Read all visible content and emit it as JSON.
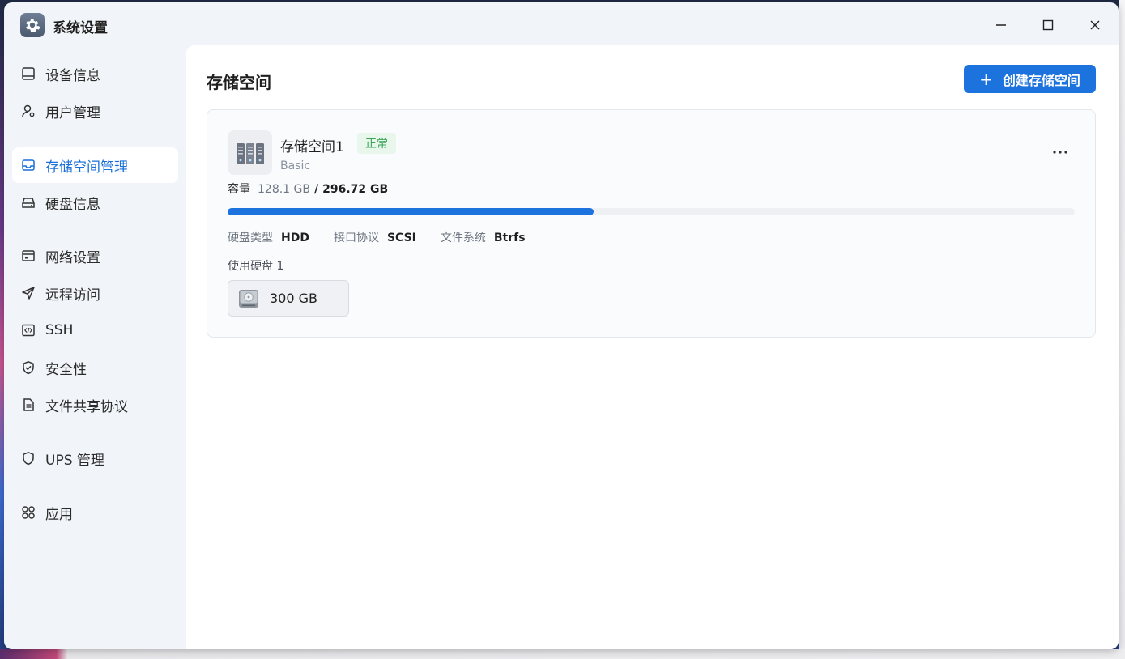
{
  "window": {
    "title": "系统设置",
    "icon": "gear-icon"
  },
  "sidebar": {
    "items": [
      {
        "label": "设备信息",
        "icon": "device-icon",
        "active": false
      },
      {
        "label": "用户管理",
        "icon": "user-settings-icon",
        "active": false
      },
      {
        "label": "存储空间管理",
        "icon": "storage-icon",
        "active": true
      },
      {
        "label": "硬盘信息",
        "icon": "hard-disk-icon",
        "active": false
      },
      {
        "label": "网络设置",
        "icon": "network-icon",
        "active": false
      },
      {
        "label": "远程访问",
        "icon": "send-icon",
        "active": false
      },
      {
        "label": "SSH",
        "icon": "code-icon",
        "active": false
      },
      {
        "label": "安全性",
        "icon": "shield-check-icon",
        "active": false
      },
      {
        "label": "文件共享协议",
        "icon": "document-icon",
        "active": false
      },
      {
        "label": "UPS 管理",
        "icon": "shield-icon",
        "active": false
      },
      {
        "label": "应用",
        "icon": "apps-icon",
        "active": false
      }
    ]
  },
  "main": {
    "title": "存储空间",
    "create_button": "创建存储空间",
    "pool": {
      "name": "存储空间1",
      "status": "正常",
      "type": "Basic",
      "capacity_label": "容量",
      "used": "128.1 GB",
      "separator": "/",
      "total": "296.72 GB",
      "usage_fraction": 0.432,
      "props": [
        {
          "key": "硬盘类型",
          "value": "HDD"
        },
        {
          "key": "接口协议",
          "value": "SCSI"
        },
        {
          "key": "文件系统",
          "value": "Btrfs"
        }
      ],
      "used_disks_label": "使用硬盘 1",
      "disks": [
        {
          "size": "300 GB"
        }
      ]
    }
  },
  "colors": {
    "accent": "#1d73dd",
    "status_ok_bg": "#e8f6ec",
    "status_ok_text": "#3aa55a",
    "sidebar_bg": "#f1f4f8",
    "card_bg": "#f9fbfd"
  }
}
